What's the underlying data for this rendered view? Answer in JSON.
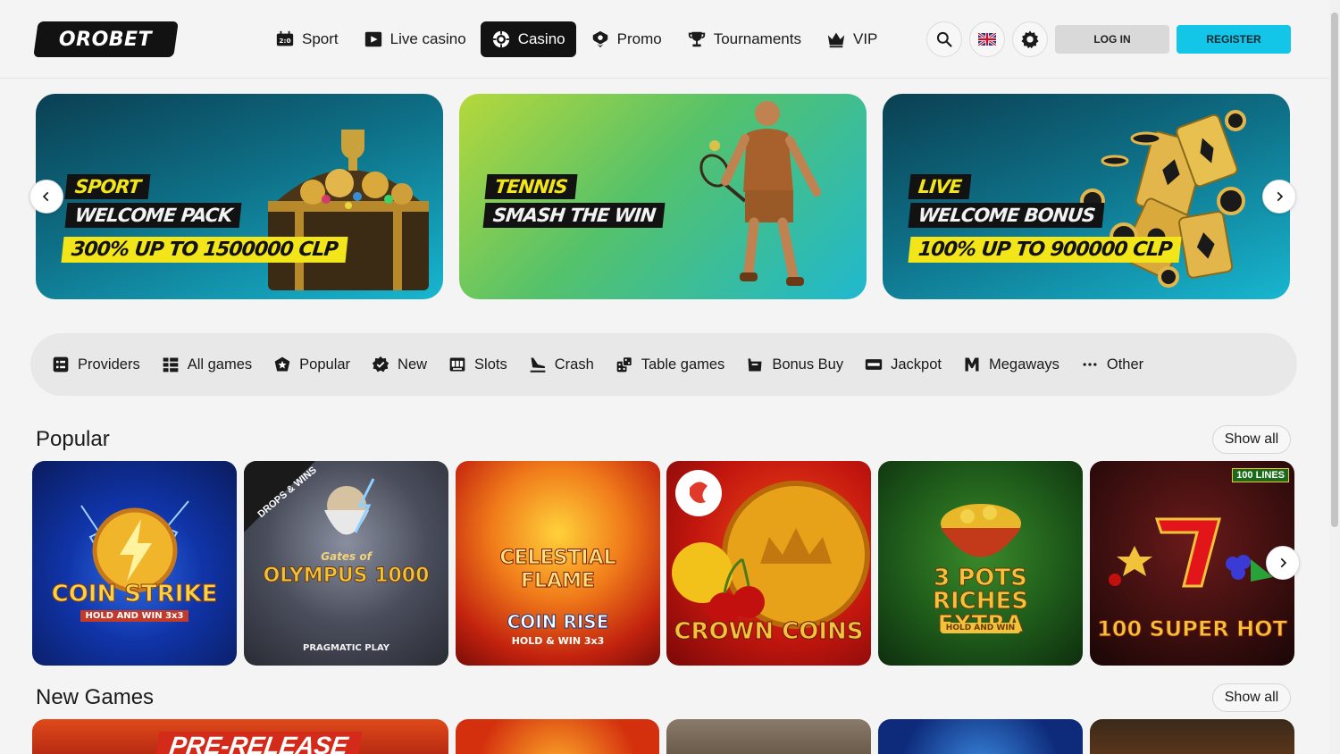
{
  "header": {
    "logo": "OROBET",
    "nav": [
      {
        "label": "Sport",
        "icon": "scoreboard-icon"
      },
      {
        "label": "Live casino",
        "icon": "play-icon"
      },
      {
        "label": "Casino",
        "icon": "casino-chip-icon",
        "active": true
      },
      {
        "label": "Promo",
        "icon": "gift-icon"
      },
      {
        "label": "Tournaments",
        "icon": "trophy-icon"
      },
      {
        "label": "VIP",
        "icon": "crown-icon"
      }
    ],
    "login": "LOG IN",
    "register": "REGISTER"
  },
  "banners": [
    {
      "line1": "SPORT",
      "line2": "WELCOME PACK",
      "line3": "300% UP TO 1500000 CLP"
    },
    {
      "line1": "TENNIS",
      "line2": "SMASH THE WIN"
    },
    {
      "line1": "LIVE",
      "line2": "WELCOME BONUS",
      "line3": "100% UP TO 900000 CLP"
    }
  ],
  "categories": [
    {
      "label": "Providers",
      "icon": "providers-icon"
    },
    {
      "label": "All games",
      "icon": "grid-icon"
    },
    {
      "label": "Popular",
      "icon": "star-badge-icon"
    },
    {
      "label": "New",
      "icon": "new-badge-icon"
    },
    {
      "label": "Slots",
      "icon": "slot-machine-icon"
    },
    {
      "label": "Crash",
      "icon": "plane-icon"
    },
    {
      "label": "Table games",
      "icon": "dice-icon"
    },
    {
      "label": "Bonus Buy",
      "icon": "shopping-bag-icon"
    },
    {
      "label": "Jackpot",
      "icon": "jackpot-icon"
    },
    {
      "label": "Megaways",
      "icon": "megaways-icon"
    },
    {
      "label": "Other",
      "icon": "more-icon"
    }
  ],
  "popular": {
    "title": "Popular",
    "show_all": "Show all",
    "games": [
      {
        "title": "COIN STRIKE",
        "subtitle": "HOLD AND WIN 3x3"
      },
      {
        "title": "OLYMPUS 1000",
        "badge": "DROPS & WINS",
        "pre": "Gates of",
        "provider": "PRAGMATIC PLAY"
      },
      {
        "title": "CELESTIAL FLAME",
        "subtitle": "COIN RISE",
        "sub2": "HOLD & WIN 3x3"
      },
      {
        "title": "CROWN COINS"
      },
      {
        "title": "3 POTS RICHES EXTRA",
        "subtitle": "HOLD AND WIN"
      },
      {
        "title": "100 SUPER HOT",
        "badge": "100 LINES"
      }
    ]
  },
  "new_games": {
    "title": "New Games",
    "show_all": "Show all",
    "first_tile": "PRE-RELEASE"
  },
  "colors": {
    "accent": "#13c6e8",
    "dark": "#121212",
    "yellow": "#f2e51a"
  }
}
